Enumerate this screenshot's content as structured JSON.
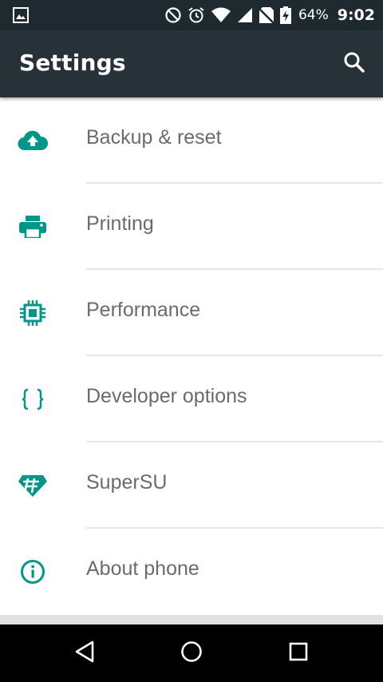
{
  "status_bar": {
    "battery_percent": "64%",
    "time": "9:02",
    "icons": [
      "image-notification-icon",
      "do-not-disturb-icon",
      "alarm-icon",
      "wifi-icon",
      "cell-signal-icon",
      "no-sim-icon",
      "battery-charging-icon"
    ]
  },
  "app_bar": {
    "title": "Settings",
    "search_icon": "search-icon"
  },
  "settings_items": [
    {
      "label": "Backup & reset",
      "icon": "cloud-upload-icon"
    },
    {
      "label": "Printing",
      "icon": "printer-icon"
    },
    {
      "label": "Performance",
      "icon": "chip-icon"
    },
    {
      "label": "Developer options",
      "icon": "code-braces-icon"
    },
    {
      "label": "SuperSU",
      "icon": "supersu-icon"
    },
    {
      "label": "About phone",
      "icon": "info-icon"
    }
  ],
  "colors": {
    "status_bar": "#1e2a30",
    "app_bar": "#263238",
    "accent": "#009688",
    "label_text": "#6b6b6b"
  },
  "nav_bar": {
    "icons": [
      "back-icon",
      "home-icon",
      "recents-icon"
    ]
  }
}
